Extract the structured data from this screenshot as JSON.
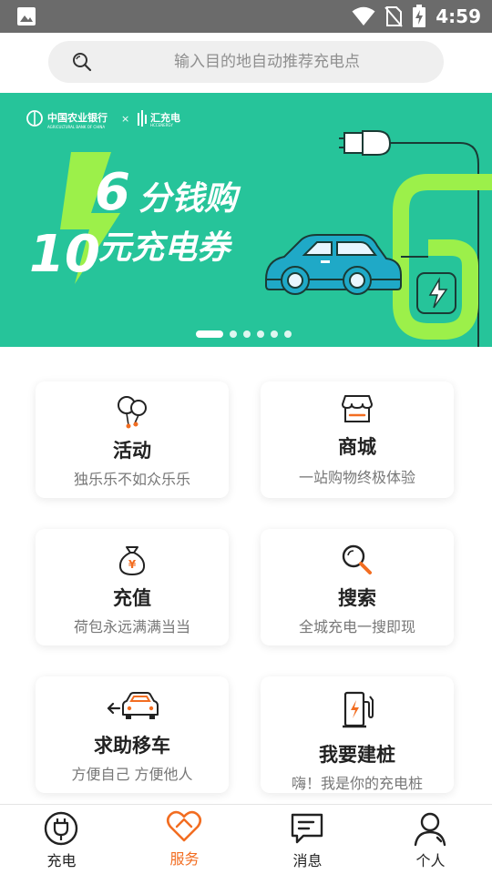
{
  "status_bar": {
    "time": "4:59",
    "icons": [
      "image-icon",
      "wifi-icon",
      "no-sim-icon",
      "battery-charging-icon"
    ]
  },
  "search": {
    "placeholder": "输入目的地自动推荐充电点"
  },
  "banner": {
    "bank_name": "中国农业银行",
    "bank_name_en": "AGRICULTURAL BANK OF CHINA",
    "times": "×",
    "partner": "汇充电",
    "partner_en": "HCCENERGY",
    "headline_line1_number": "6",
    "headline_line1_text": "分钱购",
    "headline_line2_number": "10",
    "headline_line2_text": "元充电券",
    "colors": {
      "background": "#26c49a",
      "accent": "#9cf04a",
      "car": "#1fa9c7",
      "outline": "#1a3b35"
    },
    "carousel_slide_count": 6,
    "carousel_current_slide": 1
  },
  "services": [
    {
      "icon": "balloons-icon",
      "title": "活动",
      "subtitle": "独乐乐不如众乐乐"
    },
    {
      "icon": "store-icon",
      "title": "商城",
      "subtitle": "一站购物终极体验"
    },
    {
      "icon": "money-bag-icon",
      "title": "充值",
      "subtitle": "荷包永远满满当当"
    },
    {
      "icon": "magnifier-icon",
      "title": "搜索",
      "subtitle": "全城充电一搜即现"
    },
    {
      "icon": "move-car-icon",
      "title": "求助移车",
      "subtitle": "方便自己 方便他人"
    },
    {
      "icon": "charging-pile-icon",
      "title": "我要建桩",
      "subtitle": "嗨！我是你的充电桩"
    }
  ],
  "tabs": [
    {
      "icon": "plug-icon",
      "label": "充电",
      "active": false
    },
    {
      "icon": "heart-tag-icon",
      "label": "服务",
      "active": true
    },
    {
      "icon": "message-icon",
      "label": "消息",
      "active": false
    },
    {
      "icon": "person-icon",
      "label": "个人",
      "active": false
    }
  ],
  "theme": {
    "accent": "#f26d21",
    "text": "#222222",
    "subtext": "#777777"
  }
}
